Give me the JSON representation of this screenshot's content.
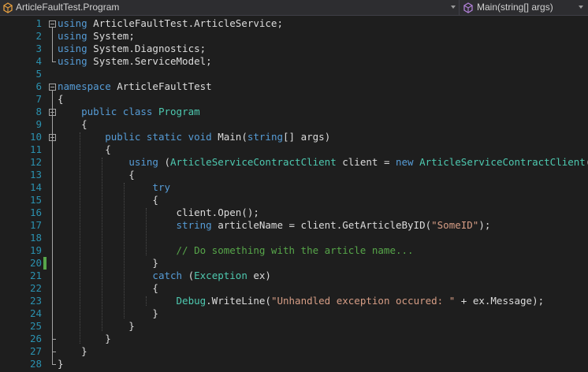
{
  "navbar": {
    "type_dropdown": "ArticleFaultTest.Program",
    "member_dropdown": "Main(string[] args)"
  },
  "line_numbers": [
    "1",
    "2",
    "3",
    "4",
    "5",
    "6",
    "7",
    "8",
    "9",
    "10",
    "11",
    "12",
    "13",
    "14",
    "15",
    "16",
    "17",
    "18",
    "19",
    "20",
    "21",
    "22",
    "23",
    "24",
    "25",
    "26",
    "27",
    "28"
  ],
  "code": [
    [
      {
        "t": "using",
        "c": "kw"
      },
      {
        "t": " ArticleFaultTest.ArticleService;"
      }
    ],
    [
      {
        "t": "using",
        "c": "kw"
      },
      {
        "t": " System;"
      }
    ],
    [
      {
        "t": "using",
        "c": "kw"
      },
      {
        "t": " System.Diagnostics;"
      }
    ],
    [
      {
        "t": "using",
        "c": "kw"
      },
      {
        "t": " System.ServiceModel;"
      }
    ],
    [],
    [
      {
        "t": "namespace",
        "c": "kw"
      },
      {
        "t": " ArticleFaultTest"
      }
    ],
    [
      {
        "t": "{"
      }
    ],
    [
      {
        "t": "    "
      },
      {
        "t": "public",
        "c": "kw"
      },
      {
        "t": " "
      },
      {
        "t": "class",
        "c": "kw"
      },
      {
        "t": " "
      },
      {
        "t": "Program",
        "c": "ty"
      }
    ],
    [
      {
        "t": "    {"
      }
    ],
    [
      {
        "t": "        "
      },
      {
        "t": "public",
        "c": "kw"
      },
      {
        "t": " "
      },
      {
        "t": "static",
        "c": "kw"
      },
      {
        "t": " "
      },
      {
        "t": "void",
        "c": "kw"
      },
      {
        "t": " Main("
      },
      {
        "t": "string",
        "c": "kw"
      },
      {
        "t": "[] args)"
      }
    ],
    [
      {
        "t": "        {"
      }
    ],
    [
      {
        "t": "            "
      },
      {
        "t": "using",
        "c": "kw"
      },
      {
        "t": " ("
      },
      {
        "t": "ArticleServiceContractClient",
        "c": "ty"
      },
      {
        "t": " client = "
      },
      {
        "t": "new",
        "c": "kw"
      },
      {
        "t": " "
      },
      {
        "t": "ArticleServiceContractClient",
        "c": "ty"
      },
      {
        "t": "())"
      }
    ],
    [
      {
        "t": "            {"
      }
    ],
    [
      {
        "t": "                "
      },
      {
        "t": "try",
        "c": "kw"
      }
    ],
    [
      {
        "t": "                {"
      }
    ],
    [
      {
        "t": "                    client.Open();"
      }
    ],
    [
      {
        "t": "                    "
      },
      {
        "t": "string",
        "c": "kw"
      },
      {
        "t": " articleName = client.GetArticleByID("
      },
      {
        "t": "\"SomeID\"",
        "c": "st"
      },
      {
        "t": ");"
      }
    ],
    [],
    [
      {
        "t": "                    "
      },
      {
        "t": "// Do something with the article name...",
        "c": "cm"
      }
    ],
    [
      {
        "t": "                }"
      }
    ],
    [
      {
        "t": "                "
      },
      {
        "t": "catch",
        "c": "kw"
      },
      {
        "t": " ("
      },
      {
        "t": "Exception",
        "c": "ty"
      },
      {
        "t": " ex)"
      }
    ],
    [
      {
        "t": "                {"
      }
    ],
    [
      {
        "t": "                    "
      },
      {
        "t": "Debug",
        "c": "ty"
      },
      {
        "t": ".WriteLine("
      },
      {
        "t": "\"Unhandled exception occured: \"",
        "c": "st"
      },
      {
        "t": " + ex.Message);"
      }
    ],
    [
      {
        "t": "                }"
      }
    ],
    [
      {
        "t": "            }"
      }
    ],
    [
      {
        "t": "        }"
      }
    ],
    [
      {
        "t": "    }"
      }
    ],
    [
      {
        "t": "}"
      }
    ]
  ],
  "modified_line": "20",
  "colors": {
    "keyword": "#569cd6",
    "type": "#4ec9b0",
    "string": "#d69d85",
    "comment": "#57a64a",
    "line_number": "#2b91af",
    "change_marker": "#57a64a"
  }
}
